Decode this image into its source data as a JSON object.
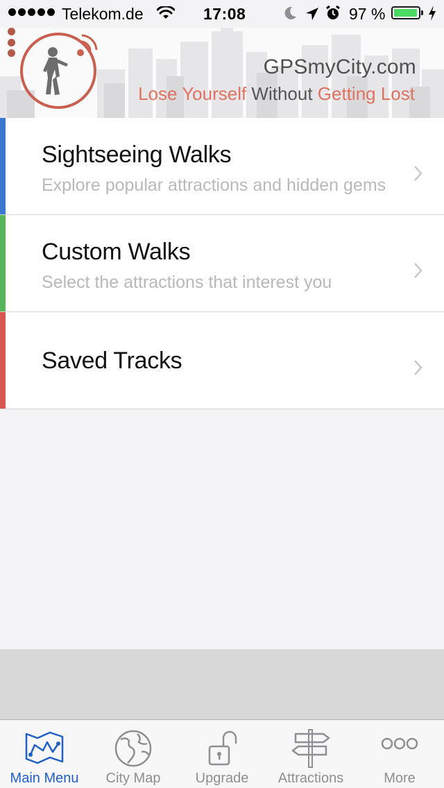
{
  "status_bar": {
    "carrier": "Telekom.de",
    "time": "17:08",
    "battery_percent": "97 %",
    "battery_level": 0.97,
    "icons": [
      "signal-dots-icon",
      "wifi-icon",
      "moon-icon",
      "location-arrow-icon",
      "alarm-icon",
      "battery-icon",
      "charging-bolt-icon"
    ]
  },
  "header": {
    "brand": "GPSmyCity.com",
    "tagline": {
      "part1": "Lose Yourself",
      "part2": " Without ",
      "part3": "Getting Lost"
    },
    "accent_color": "#df7260"
  },
  "menu": {
    "items": [
      {
        "title": "Sightseeing Walks",
        "subtitle": "Explore popular attractions and hidden gems",
        "stripe_color": "#3a78d0"
      },
      {
        "title": "Custom Walks",
        "subtitle": "Select the attractions that interest you",
        "stripe_color": "#56b45a"
      },
      {
        "title": "Saved Tracks",
        "subtitle": "",
        "stripe_color": "#d9534f"
      }
    ]
  },
  "tab_bar": {
    "active_color": "#1e5fc9",
    "inactive_color": "#8e8e93",
    "tabs": [
      {
        "label": "Main Menu",
        "icon": "map-icon",
        "active": true
      },
      {
        "label": "City Map",
        "icon": "globe-icon",
        "active": false
      },
      {
        "label": "Upgrade",
        "icon": "unlocked-padlock-icon",
        "active": false
      },
      {
        "label": "Attractions",
        "icon": "signpost-icon",
        "active": false
      },
      {
        "label": "More",
        "icon": "more-dots-icon",
        "active": false
      }
    ]
  }
}
